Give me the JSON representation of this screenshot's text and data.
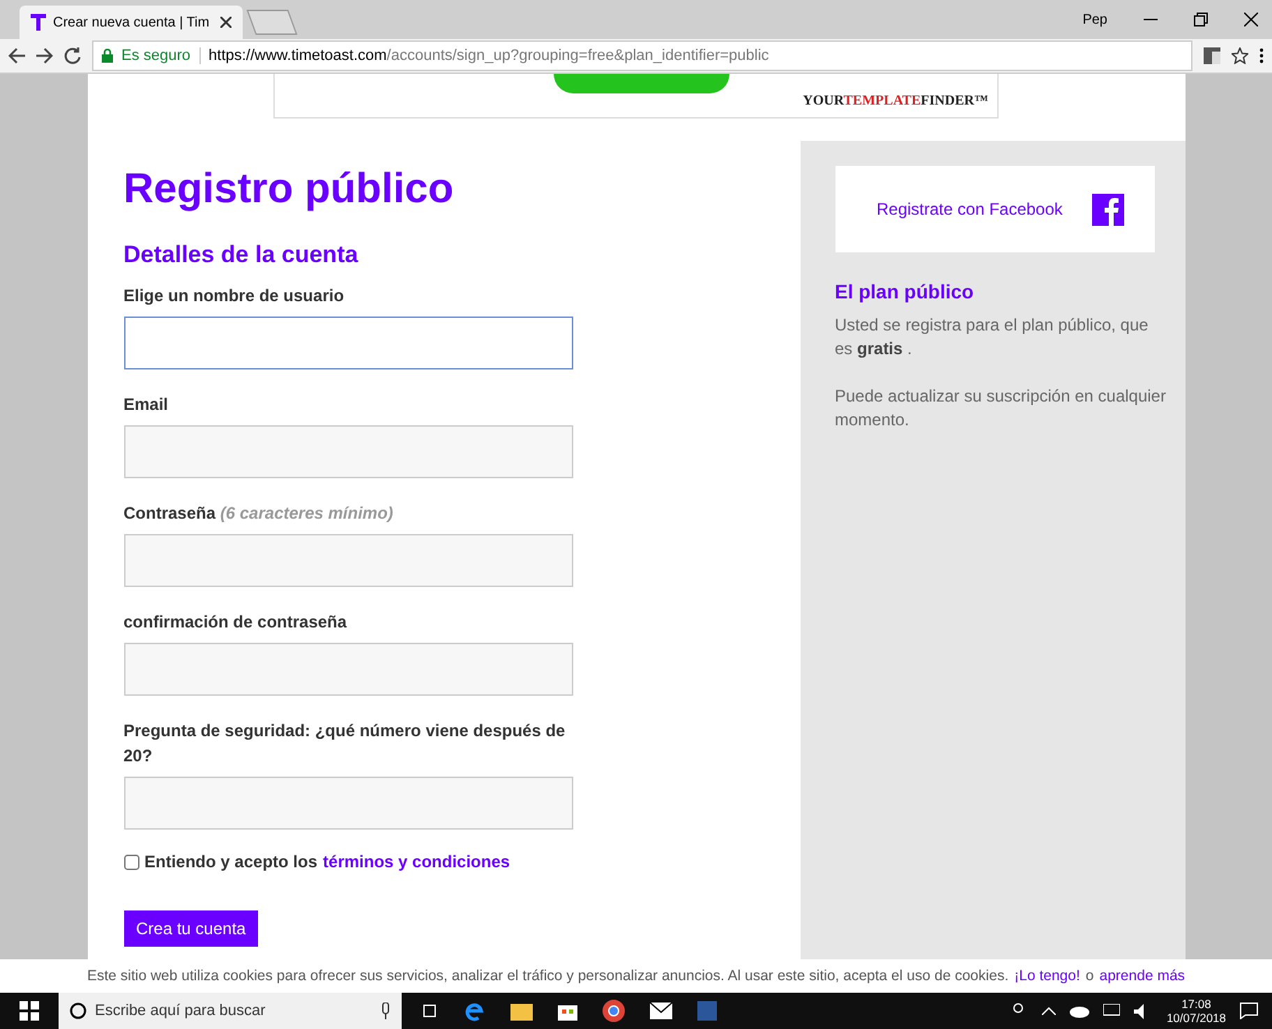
{
  "browser": {
    "tab_title": "Crear nueva cuenta | Tim",
    "user": "Pep",
    "secure_label": "Es seguro",
    "url_host": "https://www.timetoast.com",
    "url_path": "/accounts/sign_up?grouping=free&plan_identifier=public"
  },
  "ad": {
    "logo": [
      "YOUR",
      "TEMPLATE",
      "FINDER™"
    ]
  },
  "form": {
    "title": "Registro público",
    "section": "Detalles de la cuenta",
    "fields": [
      {
        "label": "Elige un nombre de usuario",
        "focused": true
      },
      {
        "label": "Email",
        "focused": false
      },
      {
        "label": "Contraseña",
        "hint": "(6 caracteres mínimo)",
        "focused": false
      },
      {
        "label": "confirmación de contraseña",
        "focused": false
      },
      {
        "label": "Pregunta de seguridad: ¿qué número viene después de 20?",
        "focused": false
      }
    ],
    "terms": {
      "checked": false,
      "text": "Entiendo y acepto los",
      "link": "términos y condiciones"
    },
    "submit": "Crea tu cuenta"
  },
  "sidebar": {
    "facebook": "Registrate con Facebook",
    "plan_title": "El plan público",
    "paragraphs": [
      "Usted se registra para el plan público, que es **gratis** .",
      "Puede actualizar su suscripción en cualquier momento."
    ]
  },
  "cookie": {
    "text": "Este sitio web utiliza cookies para ofrecer sus servicios, analizar el tráfico y personalizar anuncios. Al usar este sitio, acepta el uso de cookies.",
    "accept": "¡Lo tengo!",
    "or": "o",
    "learn": "aprende más"
  },
  "taskbar": {
    "search_placeholder": "Escribe aquí para buscar",
    "time": "17:08",
    "date": "10/07/2018"
  }
}
